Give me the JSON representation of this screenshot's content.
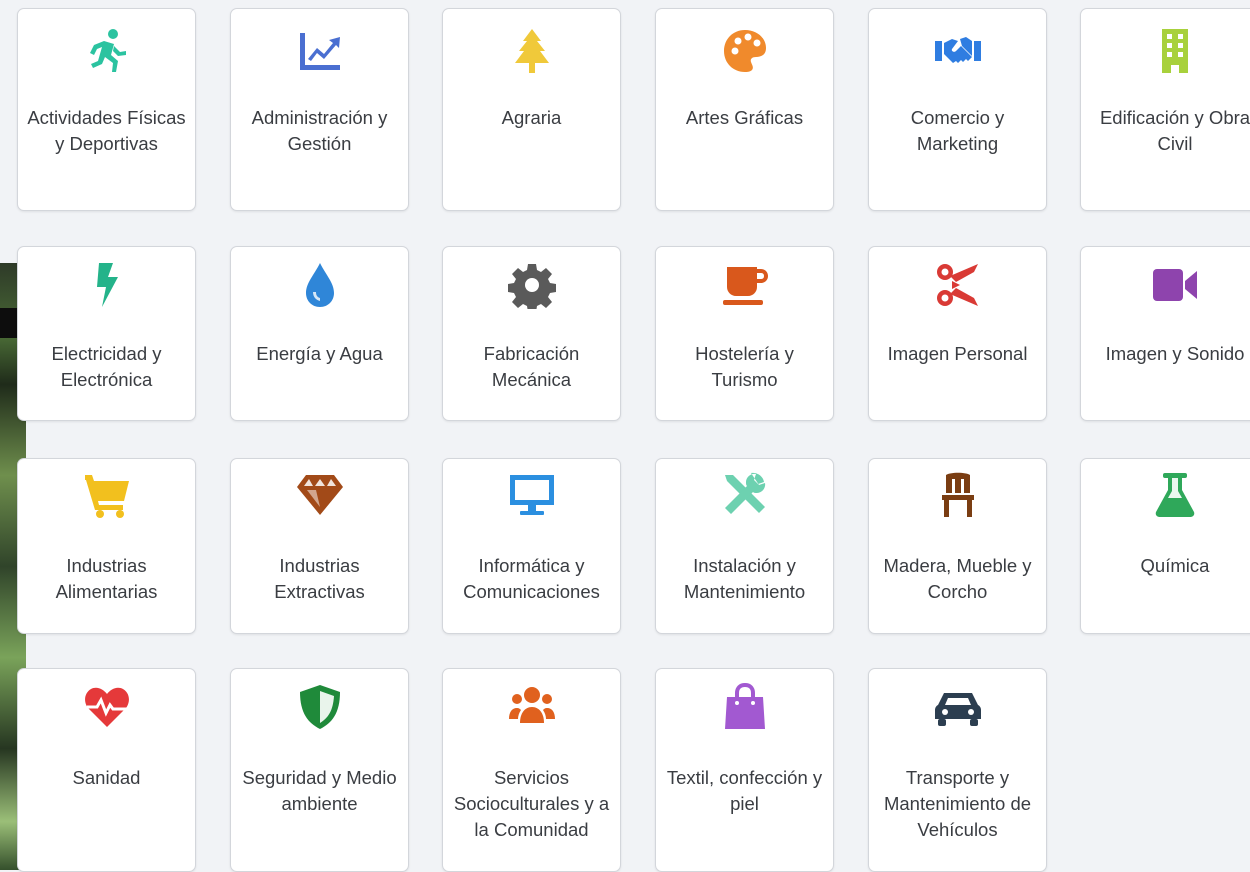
{
  "categories": [
    {
      "label": "Actividades Físicas y Deportivas",
      "icon": "running-icon",
      "color": "#2bc3a0"
    },
    {
      "label": "Administración y Gestión",
      "icon": "chart-line-icon",
      "color": "#4a6fd1"
    },
    {
      "label": "Agraria",
      "icon": "tree-icon",
      "color": "#f0c93a"
    },
    {
      "label": "Artes Gráficas",
      "icon": "palette-icon",
      "color": "#f08a2c"
    },
    {
      "label": "Comercio y Marketing",
      "icon": "handshake-icon",
      "color": "#2f7de1"
    },
    {
      "label": "Edificación y Obra Civil",
      "icon": "building-icon",
      "color": "#a8d13c"
    },
    {
      "label": "Electricidad y Electrónica",
      "icon": "bolt-icon",
      "color": "#24b38a"
    },
    {
      "label": "Energía y Agua",
      "icon": "water-drop-icon",
      "color": "#2f86d8"
    },
    {
      "label": "Fabricación Mecánica",
      "icon": "gear-icon",
      "color": "#5a5a5a"
    },
    {
      "label": "Hostelería y Turismo",
      "icon": "coffee-icon",
      "color": "#d9581c"
    },
    {
      "label": "Imagen Personal",
      "icon": "scissors-icon",
      "color": "#d93a35"
    },
    {
      "label": "Imagen y Sonido",
      "icon": "video-camera-icon",
      "color": "#8e44ad"
    },
    {
      "label": "Industrias Alimentarias",
      "icon": "shopping-cart-icon",
      "color": "#f2c01e"
    },
    {
      "label": "Industrias Extractivas",
      "icon": "gem-icon",
      "color": "#a24a18"
    },
    {
      "label": "Informática y Comunicaciones",
      "icon": "desktop-icon",
      "color": "#2b8fe0"
    },
    {
      "label": "Instalación y Mantenimiento",
      "icon": "tools-icon",
      "color": "#6dd1b0"
    },
    {
      "label": "Madera, Mueble y Corcho",
      "icon": "chair-icon",
      "color": "#7a3d12"
    },
    {
      "label": "Química",
      "icon": "flask-icon",
      "color": "#2fa85a"
    },
    {
      "label": "Sanidad",
      "icon": "heartbeat-icon",
      "color": "#e5393a"
    },
    {
      "label": "Seguridad y Medio ambiente",
      "icon": "shield-icon",
      "color": "#1f8a3a"
    },
    {
      "label": "Servicios Socioculturales y a la Comunidad",
      "icon": "users-icon",
      "color": "#e0611e"
    },
    {
      "label": "Textil, confección y piel",
      "icon": "shopping-bag-icon",
      "color": "#a259d1"
    },
    {
      "label": "Transporte y Mantenimiento de Vehículos",
      "icon": "car-icon",
      "color": "#2c3e50"
    }
  ]
}
